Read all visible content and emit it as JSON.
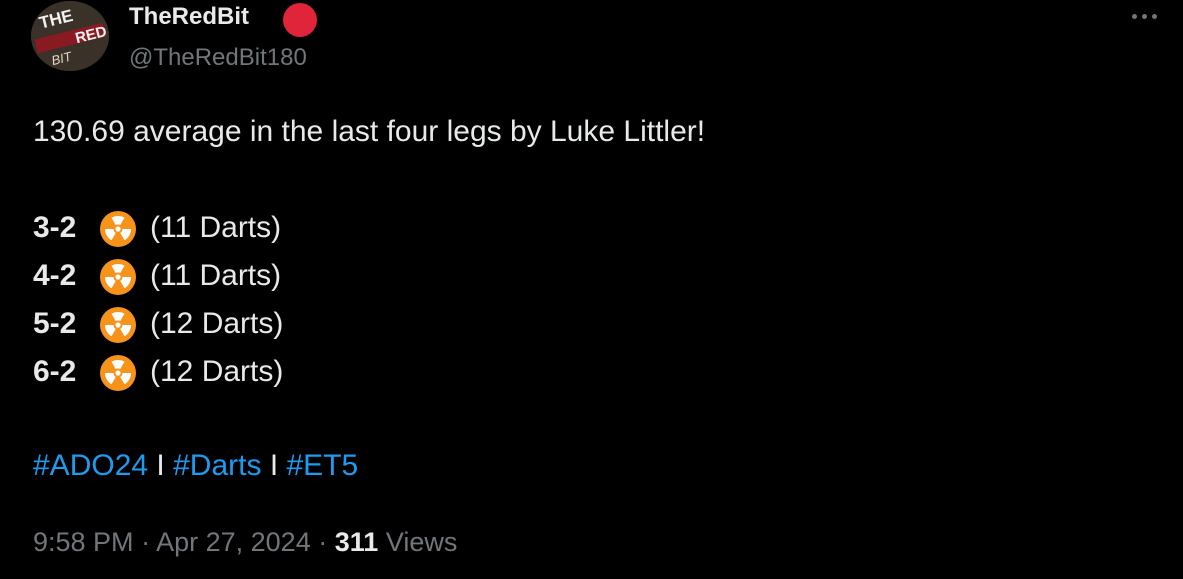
{
  "author": {
    "display_name": "TheRedBit",
    "handle": "@TheRedBit180",
    "avatar_text": [
      "THE",
      "RED",
      "BIT"
    ],
    "badge_color": "#e0243a"
  },
  "tweet": {
    "headline": "130.69 average in the last four legs by Luke Littler!",
    "legs": [
      {
        "score": "3-2",
        "darts": "(11 Darts)"
      },
      {
        "score": "4-2",
        "darts": "(11 Darts)"
      },
      {
        "score": "5-2",
        "darts": "(12 Darts)"
      },
      {
        "score": "6-2",
        "darts": "(12 Darts)"
      }
    ],
    "leg_icon": "radioactive-icon",
    "hashtags": [
      "#ADO24",
      "#Darts",
      "#ET5"
    ],
    "hashtag_separator": "I"
  },
  "meta": {
    "time": "9:58 PM",
    "dot": "·",
    "date": "Apr 27, 2024",
    "views_count": "311",
    "views_label": "Views"
  },
  "colors": {
    "background": "#000000",
    "text": "#e7e9ea",
    "muted": "#71767b",
    "link": "#1d9bf0",
    "icon": "#f7931a"
  }
}
